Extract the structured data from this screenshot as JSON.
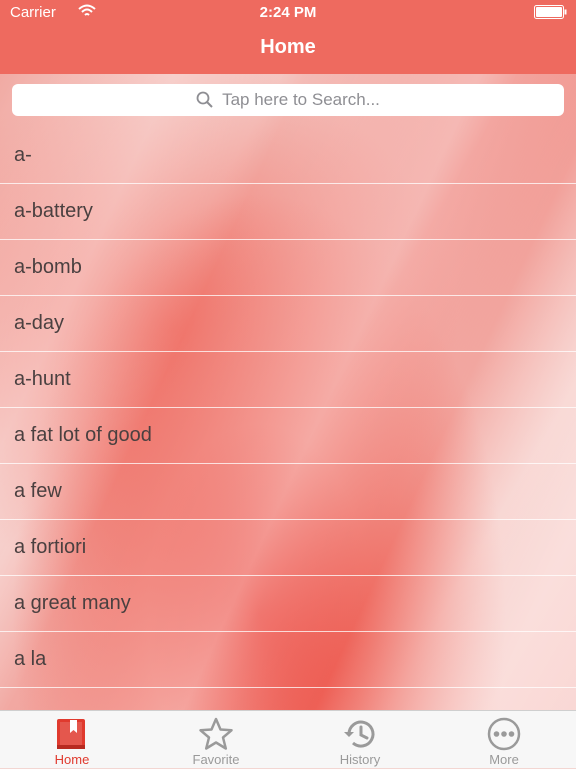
{
  "status_bar": {
    "carrier": "Carrier",
    "time": "2:24 PM"
  },
  "nav": {
    "title": "Home"
  },
  "search": {
    "placeholder": "Tap here to Search..."
  },
  "list": {
    "items": [
      "a-",
      "a-battery",
      "a-bomb",
      "a-day",
      "a-hunt",
      "a fat lot of good",
      "a few",
      "a fortiori",
      "a great many",
      "a la"
    ]
  },
  "tabs": [
    {
      "label": "Home",
      "icon": "book-icon",
      "active": true
    },
    {
      "label": "Favorite",
      "icon": "star-icon",
      "active": false
    },
    {
      "label": "History",
      "icon": "history-icon",
      "active": false
    },
    {
      "label": "More",
      "icon": "more-icon",
      "active": false
    }
  ],
  "colors": {
    "accent": "#ee6a5f",
    "active_tab": "#e03a2e",
    "inactive_tab": "#9a9a9a"
  }
}
